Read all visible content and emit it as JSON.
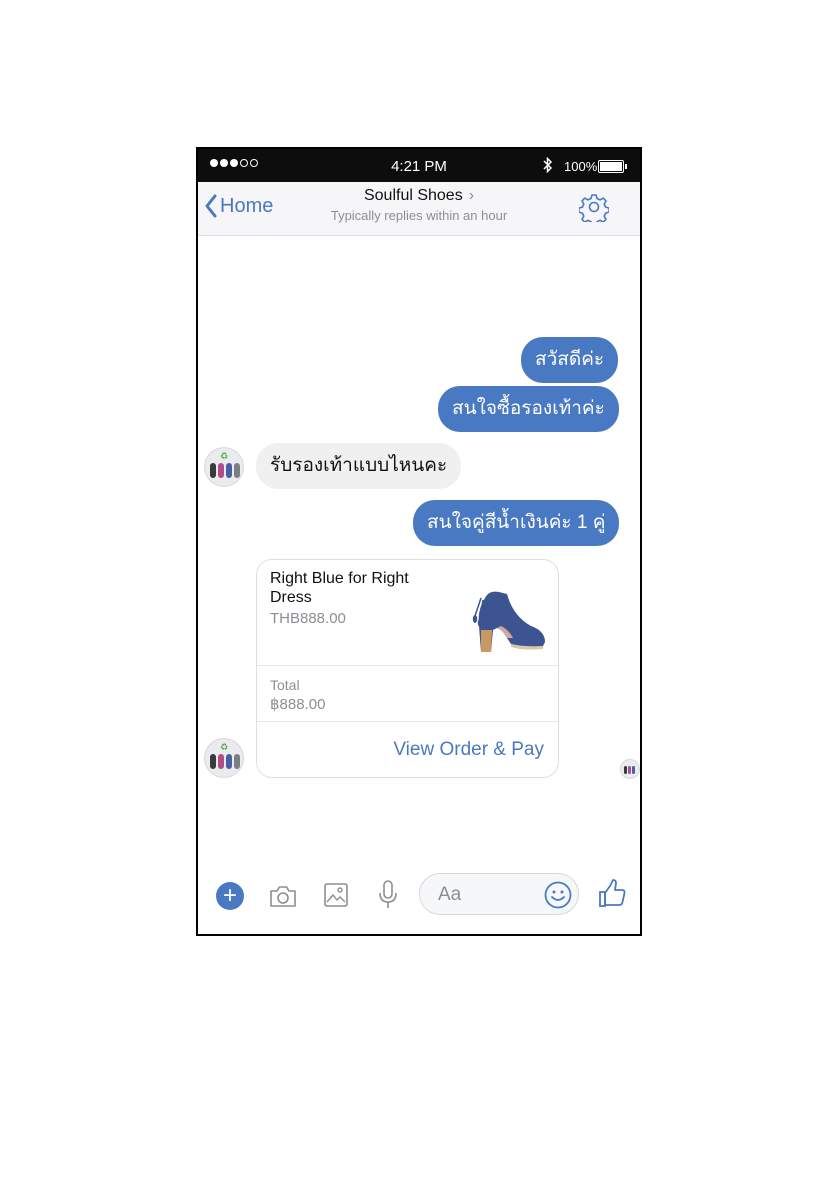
{
  "status_bar": {
    "time": "4:21 PM",
    "battery": "100%"
  },
  "header": {
    "back_label": "Home",
    "title": "Soulful Shoes",
    "subtitle": "Typically replies within an hour"
  },
  "messages": [
    {
      "from": "user",
      "text": "สวัสดีค่ะ"
    },
    {
      "from": "user",
      "text": "สนใจซื้อรองเท้าค่ะ"
    },
    {
      "from": "page",
      "text": "รับรองเท้าแบบไหนคะ"
    },
    {
      "from": "user",
      "text": "สนใจคู่สีน้ำเงินค่ะ 1 คู่"
    }
  ],
  "order_card": {
    "product_name": "Right Blue for Right Dress",
    "product_price": "THB888.00",
    "total_label": "Total",
    "total_value": "฿888.00",
    "action_label": "View Order & Pay"
  },
  "composer": {
    "placeholder": "Aa"
  },
  "colors": {
    "accent": "#4a79c3",
    "incoming_bubble": "#f1f0f0",
    "status_bar": "#0d0d0d"
  },
  "icons": [
    "chevron-left-icon",
    "gear-icon",
    "plus-icon",
    "camera-icon",
    "image-icon",
    "microphone-icon",
    "emoji-icon",
    "thumbs-up-icon",
    "bluetooth-icon",
    "battery-icon"
  ]
}
